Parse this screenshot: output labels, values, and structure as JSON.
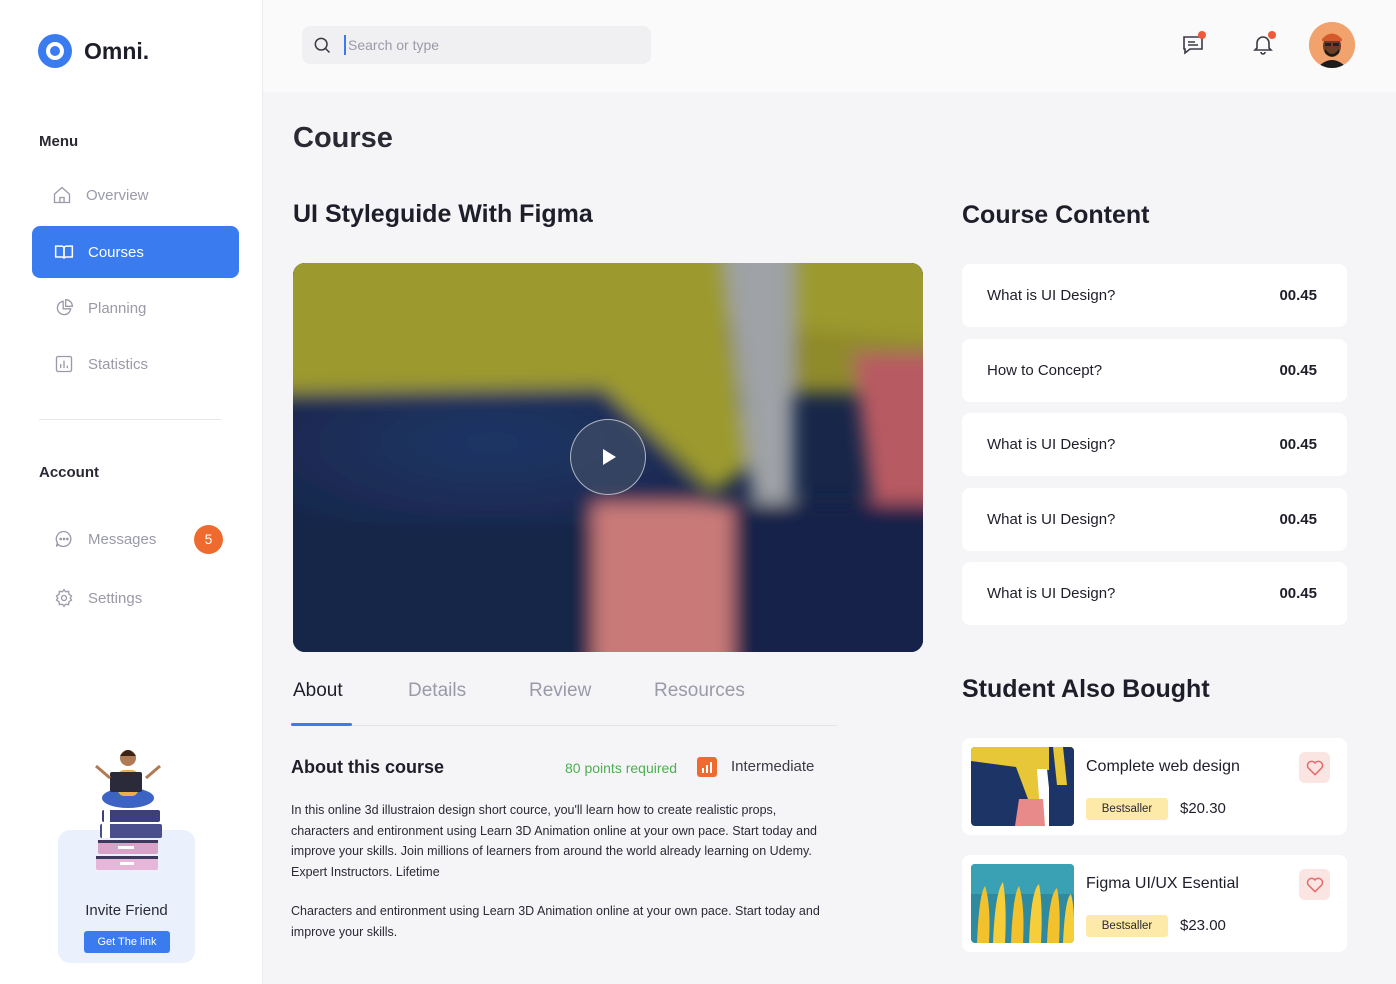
{
  "app": {
    "brand": "Omni."
  },
  "sidebar": {
    "menu_label": "Menu",
    "items": [
      {
        "label": "Overview",
        "icon": "home-icon"
      },
      {
        "label": "Courses",
        "icon": "book-icon"
      },
      {
        "label": "Planning",
        "icon": "pie-chart-icon"
      },
      {
        "label": "Statistics",
        "icon": "bar-chart-icon"
      }
    ],
    "account_label": "Account",
    "account_items": [
      {
        "label": "Messages",
        "icon": "chat-icon",
        "badge": "5"
      },
      {
        "label": "Settings",
        "icon": "gear-icon"
      }
    ],
    "invite": {
      "title": "Invite Friend",
      "button": "Get The link"
    }
  },
  "header": {
    "search_placeholder": "Search or type"
  },
  "main": {
    "page_title": "Course",
    "course_title": "UI Styleguide With Figma",
    "tabs": [
      "About",
      "Details",
      "Review",
      "Resources"
    ],
    "about": {
      "heading": "About this course",
      "points": "80 points required",
      "level": "Intermediate",
      "paragraph1": "In this online 3d illustraion design short cource, you'll learn how to create realistic props, characters and entironment using Learn 3D Animation online at your own pace. Start today and improve your skills. Join millions of learners from around the world already learning on Udemy. Expert Instructors. Lifetime",
      "paragraph2": "Characters and entironment using Learn 3D Animation online at your own pace. Start today and improve your skills."
    }
  },
  "course_content": {
    "title": "Course Content",
    "lessons": [
      {
        "title": "What is UI Design?",
        "time": "00.45"
      },
      {
        "title": "How to Concept?",
        "time": "00.45"
      },
      {
        "title": "What is UI Design?",
        "time": "00.45"
      },
      {
        "title": "What is UI Design?",
        "time": "00.45"
      },
      {
        "title": "What is UI Design?",
        "time": "00.45"
      }
    ]
  },
  "also_bought": {
    "title": "Student Also Bought",
    "products": [
      {
        "name": "Complete web design",
        "tag": "Bestsaller",
        "price": "$20.30"
      },
      {
        "name": "Figma UI/UX Esential",
        "tag": "Bestsaller",
        "price": "$23.00"
      }
    ]
  },
  "colors": {
    "accent": "#3b7bf0",
    "badge": "#ef6a2e",
    "points": "#4caf50",
    "tag": "#fdeaa8"
  }
}
